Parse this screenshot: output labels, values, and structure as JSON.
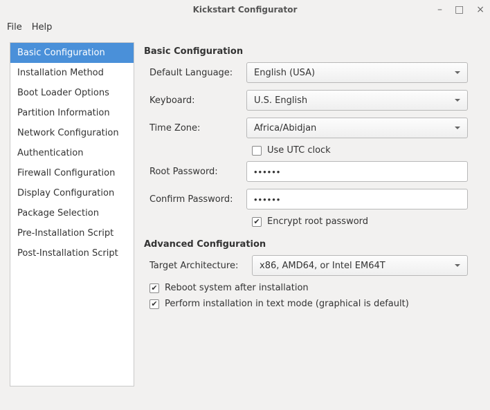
{
  "window": {
    "title": "Kickstart Configurator"
  },
  "menubar": {
    "file": "File",
    "help": "Help"
  },
  "sidebar": {
    "items": [
      {
        "label": "Basic Configuration",
        "active": true
      },
      {
        "label": "Installation Method",
        "active": false
      },
      {
        "label": "Boot Loader Options",
        "active": false
      },
      {
        "label": "Partition Information",
        "active": false
      },
      {
        "label": "Network Configuration",
        "active": false
      },
      {
        "label": "Authentication",
        "active": false
      },
      {
        "label": "Firewall Configuration",
        "active": false
      },
      {
        "label": "Display Configuration",
        "active": false
      },
      {
        "label": "Package Selection",
        "active": false
      },
      {
        "label": "Pre-Installation Script",
        "active": false
      },
      {
        "label": "Post-Installation Script",
        "active": false
      }
    ]
  },
  "basic": {
    "title": "Basic Configuration",
    "language_label": "Default Language:",
    "language_value": "English (USA)",
    "keyboard_label": "Keyboard:",
    "keyboard_value": "U.S. English",
    "timezone_label": "Time Zone:",
    "timezone_value": "Africa/Abidjan",
    "utc_label": "Use UTC clock",
    "utc_checked": false,
    "root_pw_label": "Root Password:",
    "root_pw_value": "••••••",
    "confirm_pw_label": "Confirm Password:",
    "confirm_pw_value": "••••••",
    "encrypt_label": "Encrypt root password",
    "encrypt_checked": true
  },
  "advanced": {
    "title": "Advanced Configuration",
    "arch_label": "Target Architecture:",
    "arch_value": "x86, AMD64, or Intel EM64T",
    "reboot_label": "Reboot system after installation",
    "reboot_checked": true,
    "textmode_label": "Perform installation in text mode (graphical is default)",
    "textmode_checked": true
  }
}
